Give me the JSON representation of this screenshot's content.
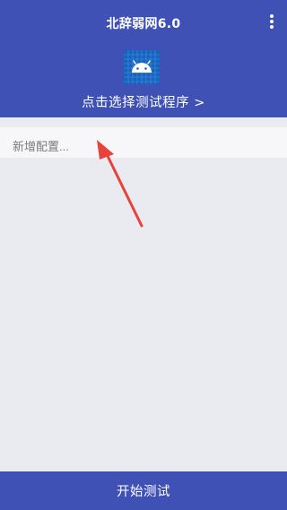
{
  "header": {
    "title": "北辞弱网6.0",
    "menu_icon": "more-vertical-icon",
    "app_icon": "android-icon",
    "select_program_label": "点击选择测试程序 >"
  },
  "config": {
    "placeholder": "新增配置..."
  },
  "footer": {
    "start_label": "开始测试"
  },
  "colors": {
    "primary": "#3f51b5",
    "background": "#e9ebf0",
    "input_background": "#f7f7f9",
    "annotation_arrow": "#e8423a"
  }
}
